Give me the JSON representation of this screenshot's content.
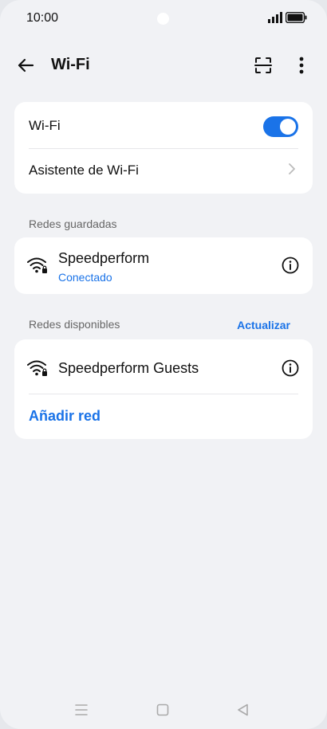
{
  "status_bar": {
    "time": "10:00",
    "signal_icon": "signal-icon",
    "battery_icon": "battery-icon"
  },
  "header": {
    "title": "Wi-Fi",
    "back_icon": "back-arrow-icon",
    "scan_icon": "qr-scan-icon",
    "more_icon": "more-vertical-icon"
  },
  "main_card": {
    "wifi_label": "Wi-Fi",
    "wifi_enabled": true,
    "assistant_label": "Asistente de Wi-Fi"
  },
  "saved_networks": {
    "section_label": "Redes guardadas",
    "items": [
      {
        "name": "Speedperform",
        "status": "Conectado",
        "icon": "wifi-locked-icon"
      }
    ]
  },
  "available_networks": {
    "section_label": "Redes disponibles",
    "refresh_label": "Actualizar",
    "items": [
      {
        "name": "Speedperform Guests",
        "icon": "wifi-locked-icon"
      }
    ],
    "add_network_label": "Añadir red"
  },
  "colors": {
    "accent": "#1a73e8",
    "background": "#f1f2f5",
    "card": "#ffffff"
  }
}
